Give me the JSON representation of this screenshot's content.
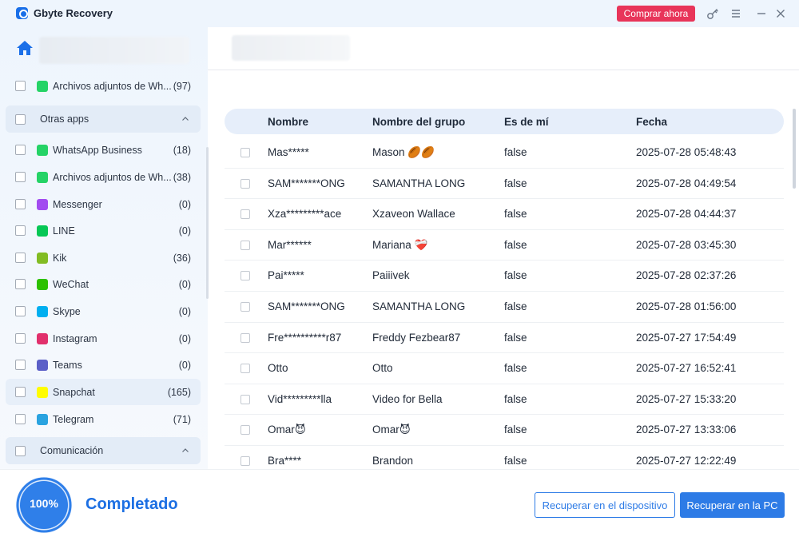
{
  "app": {
    "title": "Gbyte Recovery",
    "buy_label": "Comprar ahora"
  },
  "sidebar": {
    "rows": [
      {
        "type": "item",
        "label": "Archivos adjuntos de Wh...",
        "count": "(97)",
        "icon": "whatsapp-icon",
        "color": "#25d366"
      },
      {
        "type": "group",
        "label": "Otras apps"
      },
      {
        "type": "item",
        "label": "WhatsApp Business",
        "count": "(18)",
        "icon": "whatsapp-business-icon",
        "color": "#25d366"
      },
      {
        "type": "item",
        "label": "Archivos adjuntos de Wh...",
        "count": "(38)",
        "icon": "whatsapp-icon",
        "color": "#25d366"
      },
      {
        "type": "item",
        "label": "Messenger",
        "count": "(0)",
        "icon": "messenger-icon",
        "color": "#a24bf0"
      },
      {
        "type": "item",
        "label": "LINE",
        "count": "(0)",
        "icon": "line-icon",
        "color": "#06c755"
      },
      {
        "type": "item",
        "label": "Kik",
        "count": "(36)",
        "icon": "kik-icon",
        "color": "#82bc23"
      },
      {
        "type": "item",
        "label": "WeChat",
        "count": "(0)",
        "icon": "wechat-icon",
        "color": "#2dc100"
      },
      {
        "type": "item",
        "label": "Skype",
        "count": "(0)",
        "icon": "skype-icon",
        "color": "#00aff0"
      },
      {
        "type": "item",
        "label": "Instagram",
        "count": "(0)",
        "icon": "instagram-icon",
        "color": "#e1306c"
      },
      {
        "type": "item",
        "label": "Teams",
        "count": "(0)",
        "icon": "teams-icon",
        "color": "#5b5fc7"
      },
      {
        "type": "item",
        "label": "Snapchat",
        "count": "(165)",
        "icon": "snapchat-icon",
        "color": "#fffc00",
        "highlight": true
      },
      {
        "type": "item",
        "label": "Telegram",
        "count": "(71)",
        "icon": "telegram-icon",
        "color": "#2aa3e0"
      },
      {
        "type": "group",
        "label": "Comunicación"
      }
    ]
  },
  "table": {
    "columns": [
      "Nombre",
      "Nombre del grupo",
      "Es de mí",
      "Fecha"
    ],
    "rows": [
      [
        "Mas*****",
        "Mason 🏉🏉",
        "false",
        "2025-07-28 05:48:43"
      ],
      [
        "SAM*******ONG",
        "SAMANTHA LONG",
        "false",
        "2025-07-28 04:49:54"
      ],
      [
        "Xza*********ace",
        "Xzaveon Wallace",
        "false",
        "2025-07-28 04:44:37"
      ],
      [
        "Mar******",
        "Mariana ❤️‍🩹",
        "false",
        "2025-07-28 03:45:30"
      ],
      [
        "Pai*****",
        "Paiiivek",
        "false",
        "2025-07-28 02:37:26"
      ],
      [
        "SAM*******ONG",
        "SAMANTHA LONG",
        "false",
        "2025-07-28 01:56:00"
      ],
      [
        "Fre**********r87",
        "Freddy Fezbear87",
        "false",
        "2025-07-27 17:54:49"
      ],
      [
        "Otto",
        "Otto",
        "false",
        "2025-07-27 16:52:41"
      ],
      [
        "Vid*********lla",
        "Video for Bella",
        "false",
        "2025-07-27 15:33:20"
      ],
      [
        "Omar😈",
        "Omar😈",
        "false",
        "2025-07-27 13:33:06"
      ],
      [
        "Bra****",
        "Brandon",
        "false",
        "2025-07-27 12:22:49"
      ]
    ]
  },
  "footer": {
    "progress": "100%",
    "progress_fraction": 1.0,
    "status": "Completado",
    "recover_device_label": "Recuperar en el dispositivo",
    "recover_pc_label": "Recuperar en la PC"
  },
  "colors": {
    "accent": "#2d7be6",
    "buy": "#e8355a",
    "status": "#1c6fe3"
  }
}
